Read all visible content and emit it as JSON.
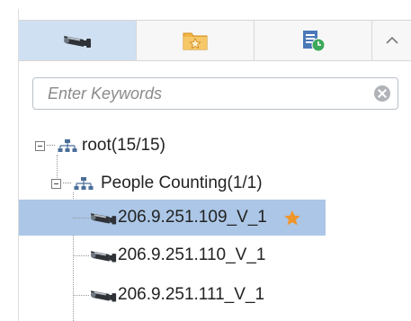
{
  "tabs": [
    {
      "name": "camera-tab",
      "icon": "camera-icon"
    },
    {
      "name": "favorites-tab",
      "icon": "star-folder-icon"
    },
    {
      "name": "schedule-tab",
      "icon": "document-clock-icon"
    },
    {
      "name": "collapse-tab",
      "icon": "chevron-up-icon"
    }
  ],
  "search": {
    "placeholder": "Enter Keywords",
    "value": ""
  },
  "tree": {
    "root": {
      "label": "root(15/15)",
      "expanded": true,
      "icon": "network-group-icon"
    },
    "group": {
      "label": "People Counting(1/1)",
      "expanded": true,
      "icon": "network-group-icon"
    },
    "items": [
      {
        "label": "206.9.251.109_V_1",
        "selected": true,
        "favorite": true,
        "icon": "camera-icon"
      },
      {
        "label": "206.9.251.110_V_1",
        "selected": false,
        "favorite": false,
        "icon": "camera-icon"
      },
      {
        "label": "206.9.251.111_V_1",
        "selected": false,
        "favorite": false,
        "icon": "camera-icon"
      }
    ]
  },
  "colors": {
    "selected_tab": "#cfe0f3",
    "selected_row": "#abc6e6",
    "star": "#f0952a",
    "camera": "#2f3338"
  }
}
